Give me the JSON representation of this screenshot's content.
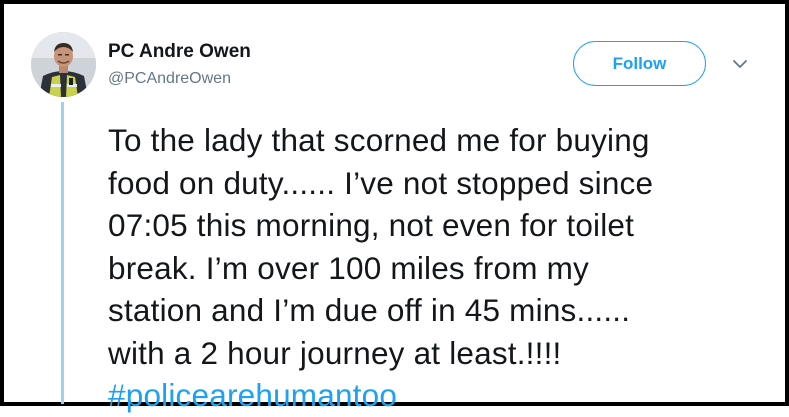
{
  "tweet": {
    "author_name": "PC Andre Owen",
    "author_handle": "@PCAndreOwen",
    "follow_label": "Follow",
    "text_lines": [
      "To the lady that scorned me for buying",
      "food on duty...... I’ve not stopped since",
      "07:05 this morning, not even for toilet",
      "break. I’m over 100 miles from my",
      "station and I’m due off in 45 mins......",
      "with a 2 hour journey at least.!!!!"
    ],
    "hashtag": "#policearehumantoo"
  },
  "icons": {
    "avatar": "profile-photo-police-officer",
    "menu": "chevron-down-icon"
  },
  "colors": {
    "accent": "#1da1f2",
    "text": "#14171a",
    "secondary_text": "#657786",
    "thread_line": "#9fd0f2",
    "border": "#000000"
  }
}
